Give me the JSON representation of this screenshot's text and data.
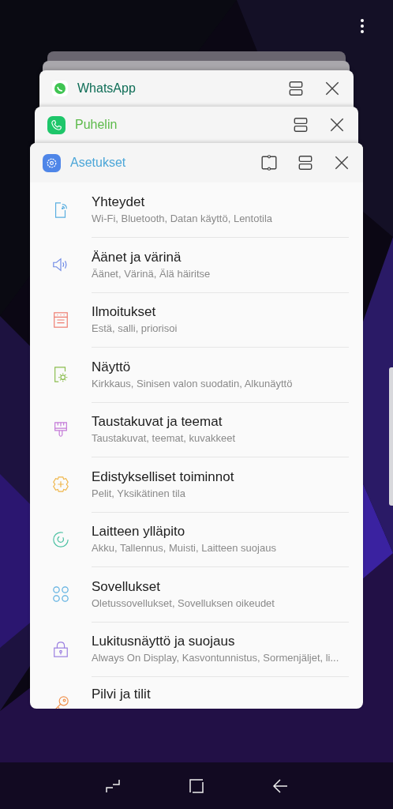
{
  "recent_apps": [
    {
      "kind": "whatsapp",
      "title": "WhatsApp",
      "popup_view": false
    },
    {
      "kind": "phone",
      "title": "Puhelin",
      "popup_view": false
    },
    {
      "kind": "settings",
      "title": "Asetukset",
      "popup_view": true
    }
  ],
  "settings_items": [
    {
      "kind": "connections",
      "title": "Yhteydet",
      "subtitle": "Wi-Fi, Bluetooth, Datan käyttö, Lentotila"
    },
    {
      "kind": "sound",
      "title": "Äänet ja värinä",
      "subtitle": "Äänet, Värinä, Älä häiritse"
    },
    {
      "kind": "notifications",
      "title": "Ilmoitukset",
      "subtitle": "Estä, salli, priorisoi"
    },
    {
      "kind": "display",
      "title": "Näyttö",
      "subtitle": "Kirkkaus, Sinisen valon suodatin, Alkunäyttö"
    },
    {
      "kind": "wallpaper",
      "title": "Taustakuvat ja teemat",
      "subtitle": "Taustakuvat, teemat, kuvakkeet"
    },
    {
      "kind": "advanced",
      "title": "Edistykselliset toiminnot",
      "subtitle": "Pelit, Yksikätinen tila"
    },
    {
      "kind": "maintenance",
      "title": "Laitteen ylläpito",
      "subtitle": "Akku, Tallennus, Muisti, Laitteen suojaus"
    },
    {
      "kind": "apps",
      "title": "Sovellukset",
      "subtitle": "Oletussovellukset, Sovelluksen oikeudet"
    },
    {
      "kind": "lock",
      "title": "Lukitusnäyttö ja suojaus",
      "subtitle": "Always On Display, Kasvontunnistus, Sormenjäljet, li..."
    },
    {
      "kind": "accounts",
      "title": "Pilvi ja tilit"
    }
  ]
}
